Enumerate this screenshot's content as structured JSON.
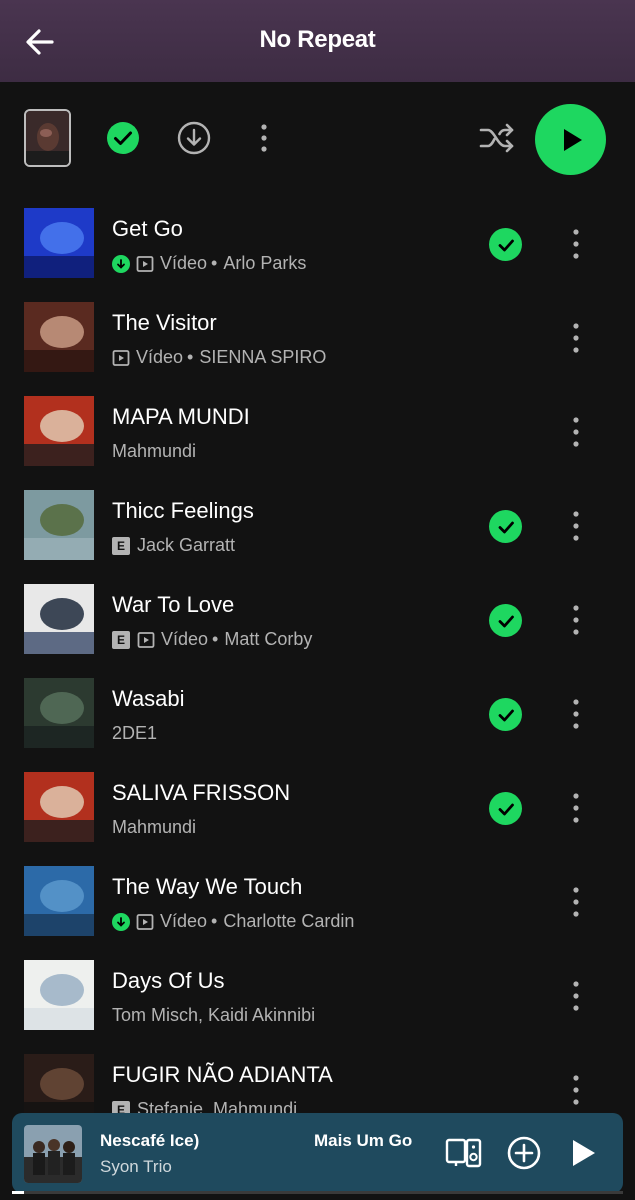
{
  "header": {
    "title": "No Repeat"
  },
  "colors": {
    "accent": "#1ed760",
    "background": "#121212",
    "header": "#43304a",
    "mini_player": "#1f4a5e"
  },
  "toolbar": {
    "icons": [
      "playlist-cover",
      "downloaded-check-icon",
      "download-icon",
      "more-icon",
      "shuffle-icon",
      "play-icon"
    ]
  },
  "tracks": [
    {
      "title": "Get Go",
      "downloaded": true,
      "explicit": false,
      "video": true,
      "video_label": "Vídeo",
      "artist": "Arlo Parks",
      "liked": true
    },
    {
      "title": "The Visitor",
      "downloaded": false,
      "explicit": false,
      "video": true,
      "video_label": "Vídeo",
      "artist": "SIENNA SPIRO",
      "liked": false
    },
    {
      "title": "MAPA MUNDI",
      "downloaded": false,
      "explicit": false,
      "video": false,
      "artist": "Mahmundi",
      "liked": false
    },
    {
      "title": "Thicc Feelings",
      "downloaded": false,
      "explicit": true,
      "video": false,
      "artist": "Jack Garratt",
      "liked": true
    },
    {
      "title": "War To Love",
      "downloaded": false,
      "explicit": true,
      "video": true,
      "video_label": "Vídeo",
      "artist": "Matt Corby",
      "liked": true
    },
    {
      "title": "Wasabi",
      "downloaded": false,
      "explicit": false,
      "video": false,
      "artist": "2DE1",
      "liked": true
    },
    {
      "title": "SALIVA FRISSON",
      "downloaded": false,
      "explicit": false,
      "video": false,
      "artist": "Mahmundi",
      "liked": true
    },
    {
      "title": "The Way We Touch",
      "downloaded": true,
      "explicit": false,
      "video": true,
      "video_label": "Vídeo",
      "artist": "Charlotte Cardin",
      "liked": false
    },
    {
      "title": "Days Of Us",
      "downloaded": false,
      "explicit": false,
      "video": false,
      "artist": "Tom Misch, Kaidi Akinnibi",
      "liked": false
    },
    {
      "title": "FUGIR NÃO ADIANTA",
      "downloaded": false,
      "explicit": true,
      "video": false,
      "artist": "Stefanie, Mahmundi",
      "liked": false
    }
  ],
  "mini_player": {
    "title": "Nescafé Ice)",
    "next_title": "Mais Um Go",
    "artist": "Syon Trio",
    "progress": 0.02
  }
}
